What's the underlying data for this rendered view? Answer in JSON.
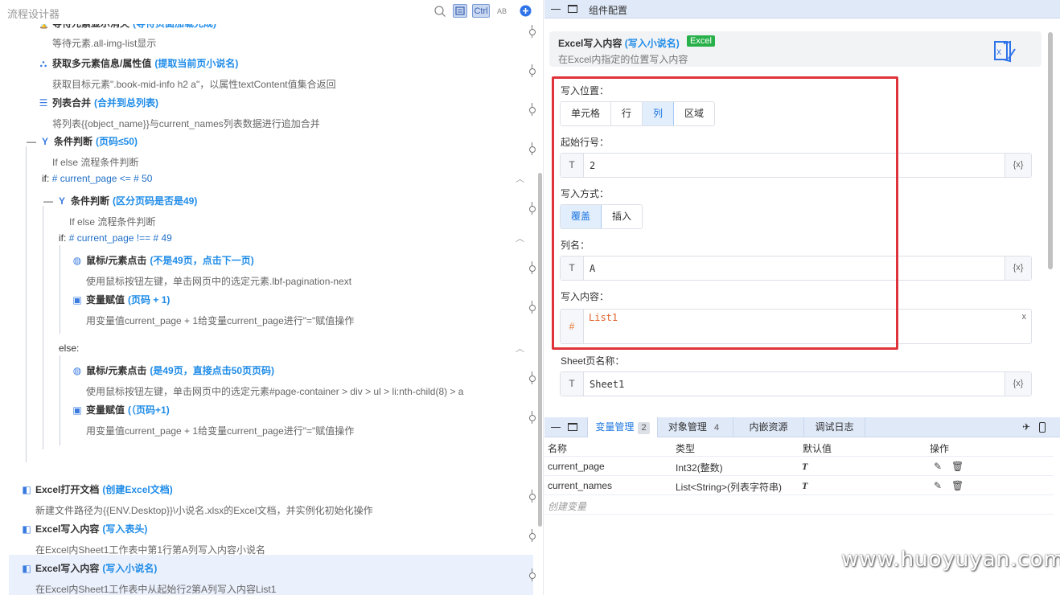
{
  "left": {
    "title": "流程设计器",
    "toolbar": {
      "ctrl_label": "Ctrl",
      "ab_label": "AB"
    },
    "steps": [
      {
        "name": "等待元素显示消失",
        "tag": "(等待页面加载完成)",
        "desc": "等待元素.all-img-list显示",
        "icon": "wait-icon"
      },
      {
        "name": "获取多元素信息/属性值",
        "tag": "(提取当前页小说名)",
        "desc": "获取目标元素\".book-mid-info h2 a\"，以属性textContent值集合返回",
        "icon": "elements-icon"
      },
      {
        "name": "列表合并",
        "tag": "(合并到总列表)",
        "desc": "将列表{{object_name}}与current_names列表数据进行追加合并",
        "icon": "list-merge-icon"
      },
      {
        "name": "条件判断",
        "tag": "(页码≤50)",
        "desc": "If else 流程条件判断",
        "icon": "condition-icon"
      },
      {
        "name": "条件判断",
        "tag": "(区分页码是否是49)",
        "desc": "If else 流程条件判断",
        "icon": "condition-icon"
      },
      {
        "name": "鼠标/元素点击",
        "tag": "(不是49页，点击下一页)",
        "desc": "使用鼠标按钮左键，单击网页中的选定元素.lbf-pagination-next",
        "icon": "mouse-icon"
      },
      {
        "name": "变量赋值",
        "tag": "(页码 + 1)",
        "desc": "用变量值current_page + 1给变量current_page进行\"=\"赋值操作",
        "icon": "assign-icon"
      },
      {
        "name": "鼠标/元素点击",
        "tag": "(是49页，直接点击50页页码)",
        "desc": "使用鼠标按钮左键，单击网页中的选定元素#page-container > div > ul > li:nth-child(8) > a",
        "icon": "mouse-icon"
      },
      {
        "name": "变量赋值",
        "tag": "(（页码+1)",
        "desc": "用变量值current_page + 1给变量current_page进行\"=\"赋值操作",
        "icon": "assign-icon"
      },
      {
        "name": "Excel打开文档",
        "tag": "(创建Excel文档)",
        "desc": "新建文件路径为{{ENV.Desktop}}\\小说名.xlsx的Excel文档，并实例化初始化操作",
        "icon": "excel-icon"
      },
      {
        "name": "Excel写入内容",
        "tag": "(写入表头)",
        "desc": "在Excel内Sheet1工作表中第1行第A列写入内容小说名",
        "icon": "excel-write-icon"
      },
      {
        "name": "Excel写入内容",
        "tag": "(写入小说名)",
        "desc": "在Excel内Sheet1工作表中从起始行2第A列写入内容List1",
        "icon": "excel-write-icon"
      }
    ],
    "conditions": {
      "if1_kw": "if:",
      "if1_expr": "# current_page <= # 50",
      "if2_kw": "if:",
      "if2_expr": "# current_page !== # 49",
      "else_kw": "else:"
    }
  },
  "right": {
    "header_title": "组件配置",
    "card": {
      "name": "Excel写入内容",
      "tag": "(写入小说名)",
      "badge": "Excel",
      "desc": "在Excel内指定的位置写入内容"
    },
    "form": {
      "position_label": "写入位置：",
      "position_options": [
        "单元格",
        "行",
        "列",
        "区域"
      ],
      "position_selected": 2,
      "start_row_label": "起始行号：",
      "start_row_type": "T",
      "start_row_value": "2",
      "var_btn": "{x}",
      "mode_label": "写入方式：",
      "mode_options": [
        "覆盖",
        "插入"
      ],
      "mode_selected": 0,
      "col_label": "列名：",
      "col_type": "T",
      "col_value": "A",
      "content_label": "写入内容：",
      "content_type": "#",
      "content_value": "List1",
      "content_clear": "x",
      "sheet_label": "Sheet页名称：",
      "sheet_type": "T",
      "sheet_value": "Sheet1"
    },
    "bottom": {
      "tabs": [
        {
          "label": "变量管理",
          "count": "2"
        },
        {
          "label": "对象管理",
          "count": "4"
        },
        {
          "label": "内嵌资源",
          "count": ""
        },
        {
          "label": "调试日志",
          "count": ""
        }
      ],
      "columns": [
        "名称",
        "类型",
        "默认值",
        "操作"
      ],
      "rows": [
        {
          "name": "current_page",
          "type": "Int32(整数)",
          "default": "T"
        },
        {
          "name": "current_names",
          "type": "List<String>(列表字符串)",
          "default": "T"
        }
      ],
      "create_label": "创建变量"
    }
  },
  "watermark": "www.huoyuyan.com",
  "colors": {
    "accent": "#1f78e0",
    "red_highlight": "#e0323a",
    "badge_green": "#28b04a",
    "header_bg": "#dfe9f8"
  }
}
